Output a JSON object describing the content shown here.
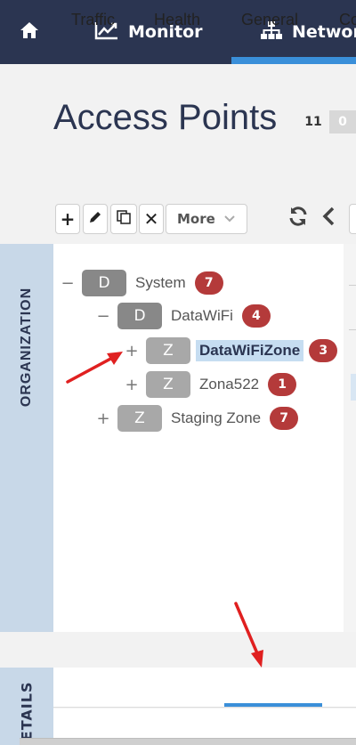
{
  "nav": {
    "items": [
      {
        "label": "",
        "icon": "home-icon"
      },
      {
        "label": "Monitor",
        "icon": "chart-line-icon"
      },
      {
        "label": "Network",
        "icon": "network-tree-icon"
      }
    ],
    "active_accent": "#3a8fd9"
  },
  "page": {
    "title": "Access Points",
    "counts": [
      "11",
      "0"
    ]
  },
  "toolbar": {
    "add_label": "+",
    "delete_label": "✕",
    "more_label": "More"
  },
  "sidebar": {
    "organization_label": "ORGANIZATION",
    "details_label": "DETAILS"
  },
  "tree": {
    "nodes": [
      {
        "toggle": "−",
        "type": "D",
        "label": "System",
        "count": "7",
        "level": 0
      },
      {
        "toggle": "−",
        "type": "D",
        "label": "DataWiFi",
        "count": "4",
        "level": 1
      },
      {
        "toggle": "+",
        "type": "Z",
        "label": "DataWiFiZone",
        "count": "3",
        "level": 2,
        "selected": true
      },
      {
        "toggle": "+",
        "type": "Z",
        "label": "Zona522",
        "count": "1",
        "level": 2
      },
      {
        "toggle": "+",
        "type": "Z",
        "label": "Staging Zone",
        "count": "7",
        "level": 1
      }
    ]
  },
  "tabs": [
    "Traffic",
    "Health",
    "General",
    "Co"
  ],
  "active_tab": "General",
  "colors": {
    "nav_bg": "#2b3551",
    "count_badge": "#b43a3a",
    "selection": "#c6ddf1",
    "annotation_arrow": "#e02020"
  }
}
